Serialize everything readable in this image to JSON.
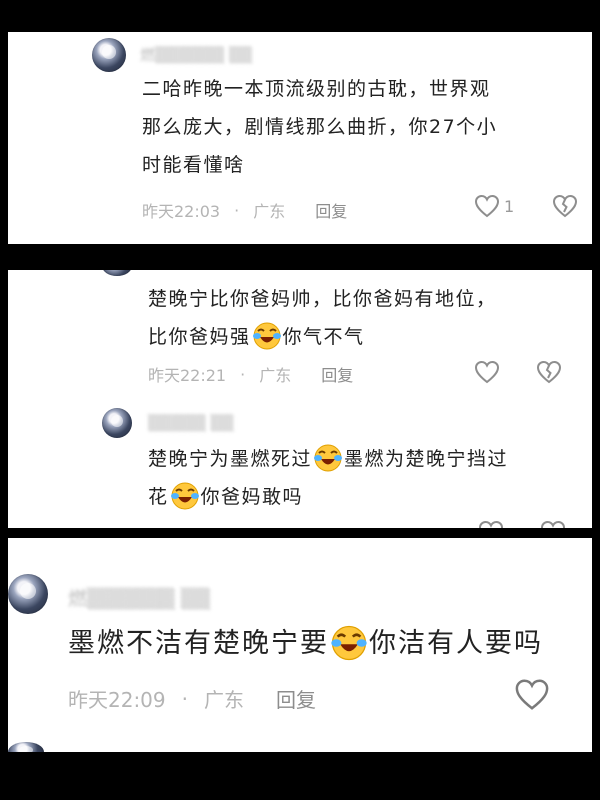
{
  "comments": [
    {
      "username": "燃▒▒▒▒▒▒ ▒▒",
      "text_line1": "二哈昨晚一本顶流级别的古耽，世界观",
      "text_line2": "那么庞大，剧情线那么曲折，你27个小",
      "text_line3": "时能看懂啥",
      "time": "昨天22:03",
      "location": "广东",
      "reply_label": "回复",
      "like_count": "1",
      "icons": [
        "heart-icon",
        "broken-heart-icon"
      ]
    },
    {
      "text_line1": "楚晚宁比你爸妈帅，比你爸妈有地位，",
      "text_line2_a": "比你爸妈强",
      "text_line2_b": "你气不气",
      "emoji": "crying-laugh-emoji",
      "time": "昨天22:21",
      "location": "广东",
      "reply_label": "回复",
      "icons": [
        "heart-icon",
        "broken-heart-icon"
      ]
    },
    {
      "username": "▒▒▒▒▒ ▒▒",
      "text_line1_a": "楚晚宁为墨燃死过",
      "text_line1_b": "墨燃为楚晚宁挡过",
      "text_line2_a": "花",
      "text_line2_b": "你爸妈敢吗",
      "emoji": "crying-laugh-emoji"
    },
    {
      "username": "燃▒▒▒▒▒▒ ▒▒",
      "text_a": "墨燃不洁有楚晚宁要",
      "text_b": "你洁有人要吗",
      "emoji": "crying-laugh-emoji",
      "time": "昨天22:09",
      "location": "广东",
      "reply_label": "回复",
      "icons": [
        "heart-icon"
      ]
    }
  ],
  "colors": {
    "background": "#000000",
    "panel": "#ffffff",
    "meta": "#b4b4b4",
    "text": "#222222"
  }
}
